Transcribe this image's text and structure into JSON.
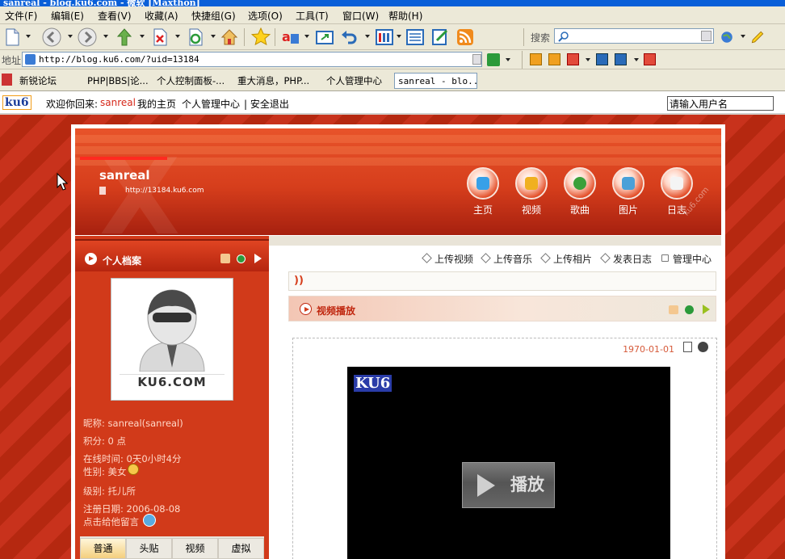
{
  "window": {
    "title": "sanreal - blog.ku6.com - 微软 [Maxthon]"
  },
  "menu": [
    "文件(F)",
    "编辑(E)",
    "查看(V)",
    "收藏(A)",
    "快捷组(G)",
    "选项(O)",
    "工具(T)",
    "窗口(W)",
    "帮助(H)"
  ],
  "toolbar": {
    "search_label": "搜索"
  },
  "address": {
    "label": "地址",
    "url": "http://blog.ku6.com/?uid=13184"
  },
  "tabs": [
    "新锐论坛",
    "PHP|BBS|论...",
    "个人控制面板-...",
    "重大消息，PHP...",
    "个人管理中心",
    "sanreal - blo..."
  ],
  "welcome": {
    "logo": "ku6",
    "greeting": "欢迎你回来:",
    "username": "sanreal",
    "my_home": "我的主页",
    "manage": "个人管理中心",
    "logout": "| 安全退出",
    "user_placeholder": "请输入用户名"
  },
  "banner": {
    "name": "sanreal",
    "url": "http://13184.ku6.com",
    "watermark": "ku6.com",
    "nav": [
      "主页",
      "视频",
      "歌曲",
      "图片",
      "日志"
    ]
  },
  "profile": {
    "title": "个人档案",
    "avatar_text": "KU6.COM",
    "nickname": "昵称: sanreal(sanreal)",
    "points": "积分: 0 点",
    "online": "在线时间: 0天0小时4分",
    "gender": "性别: 美女",
    "level": "级别: 托儿所",
    "register": "注册日期: 2006-08-08",
    "message": "点击给他留言",
    "tabs": [
      "普通",
      "头贴",
      "视频",
      "虚拟"
    ]
  },
  "actions": [
    "上传视频",
    "上传音乐",
    "上传相片",
    "发表日志",
    "管理中心"
  ],
  "video": {
    "section_title": "视频播放",
    "date": "1970-01-01",
    "player_logo": "KU6",
    "play_label": "播放"
  }
}
